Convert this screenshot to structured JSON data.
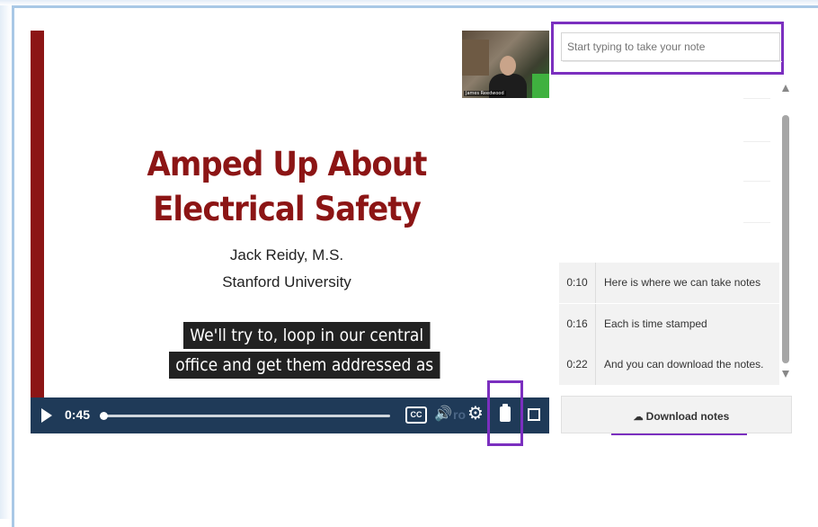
{
  "video": {
    "slide_title_line1": "Amped Up About",
    "slide_title_line2": "Electrical Safety",
    "presenter": "Jack Reidy, M.S.",
    "institution": "Stanford University",
    "caption_line1": "We'll try to, loop in our central",
    "caption_line2": "office and get them addressed as",
    "webcam_label": "James Reedwood",
    "current_time": "0:45",
    "progress": 0.0,
    "behind_text": "ro",
    "cc_label": "CC"
  },
  "notes": {
    "input_placeholder": "Start typing to take your note",
    "entries": [
      {
        "time": "0:10",
        "text": "Here is where we can take notes"
      },
      {
        "time": "0:16",
        "text": "Each is time stamped"
      },
      {
        "time": "0:22",
        "text": "And you can download the notes."
      }
    ],
    "download_label": "Download notes"
  },
  "colors": {
    "accent": "#8c1515",
    "control_bar": "#1f3a58",
    "highlight": "#7b2fbf"
  },
  "icons": [
    "play-icon",
    "cc-icon",
    "volume-icon",
    "gear-icon",
    "notes-icon",
    "fullscreen-icon",
    "cloud-download-icon"
  ]
}
